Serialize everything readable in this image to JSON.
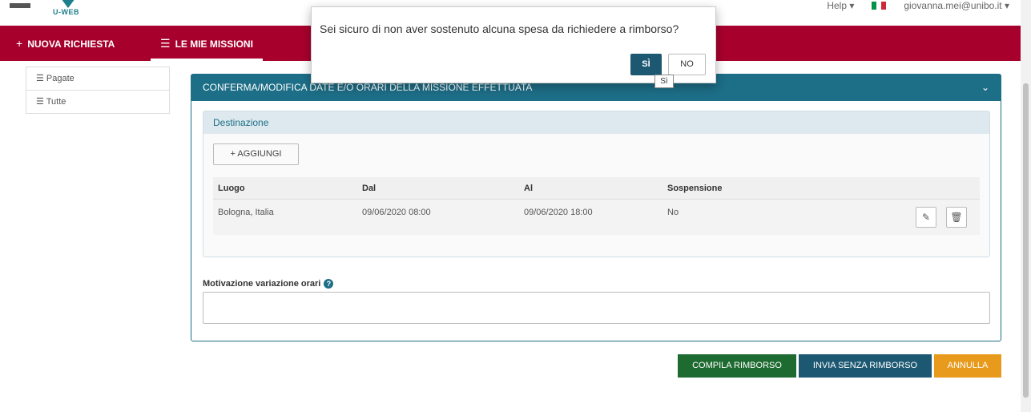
{
  "header": {
    "logo_text": "U-WEB",
    "help_label": "Help ▾",
    "user_label": "giovanna.mei@unibo.it ▾",
    "flag_colors": [
      "#009246",
      "#ffffff",
      "#ce2b37"
    ]
  },
  "nav": {
    "new_request": "NUOVA RICHIESTA",
    "my_missions": "LE MIE MISSIONI"
  },
  "sidemenu": {
    "items": [
      {
        "label": "Pagate"
      },
      {
        "label": "Tutte"
      }
    ]
  },
  "panel": {
    "title": "CONFERMA/MODIFICA DATE E/O ORARI DELLA MISSIONE EFFETTUATA",
    "destination": {
      "title": "Destinazione",
      "add_label": "AGGIUNGI",
      "columns": [
        "Luogo",
        "Dal",
        "Al",
        "Sospensione"
      ],
      "rows": [
        {
          "luogo": "Bologna, Italia",
          "dal": "09/06/2020 08:00",
          "al": "09/06/2020 18:00",
          "sospensione": "No"
        }
      ]
    },
    "motivation_label": "Motivazione variazione orari"
  },
  "actions": {
    "compile": "COMPILA RIMBORSO",
    "send_no_refund": "INVIA SENZA RIMBORSO",
    "cancel": "ANNULLA"
  },
  "dialog": {
    "message": "Sei sicuro di non aver sostenuto alcuna spesa da richiedere a rimborso?",
    "yes_label": "SÌ",
    "no_label": "NO",
    "tooltip": "Sì"
  },
  "colors": {
    "brand_red": "#a8002d",
    "panel_teal": "#1d6e87",
    "compile_green": "#1e6b31",
    "send_blue": "#1d5872",
    "cancel_orange": "#e79a1c"
  }
}
